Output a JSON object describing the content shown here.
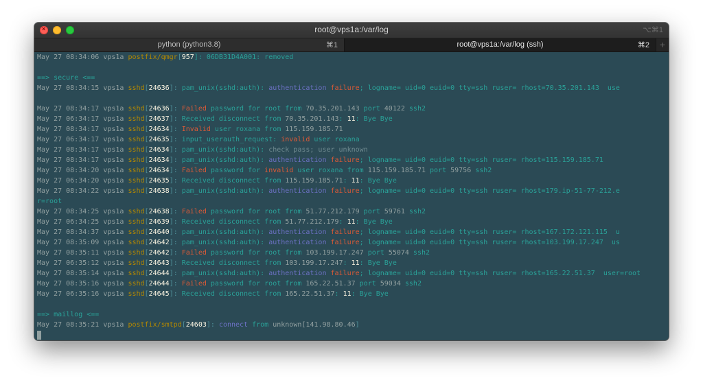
{
  "window": {
    "title": "root@vps1a:/var/log",
    "shortcut": "⌥⌘1",
    "close_glyph": "×"
  },
  "tabs": [
    {
      "label": "python (python3.8)",
      "shortcut": "⌘1",
      "active": false
    },
    {
      "label": "root@vps1a:/var/log (ssh)",
      "shortcut": "⌘2",
      "active": true
    }
  ],
  "new_tab_label": "+",
  "colors": {
    "terminal_bg": "#2b4a55",
    "text": "#93a1a1",
    "process": "#b58900",
    "pid": "#fdf6e3",
    "message_cyan": "#2aa198",
    "keyword_blue": "#6c71c4",
    "error_red": "#dc5a37"
  },
  "terminal": {
    "lines": [
      [
        [
          "May 27 08:34:06 vps1a ",
          "base"
        ],
        [
          "postfix/qmgr",
          "pfx"
        ],
        [
          "[",
          "dim"
        ],
        [
          "957",
          "pid"
        ],
        [
          "]: 06DB31D4A001: removed",
          "cyan"
        ]
      ],
      [],
      [
        [
          "==> secure <==",
          "cyan"
        ]
      ],
      [
        [
          "May 27 08:34:15 vps1a ",
          "base"
        ],
        [
          "sshd",
          "pfx"
        ],
        [
          "[",
          "dim"
        ],
        [
          "24636",
          "pid"
        ],
        [
          "]: ",
          "dim"
        ],
        [
          "pam_unix(sshd:auth): ",
          "cyan"
        ],
        [
          "authentication ",
          "blue"
        ],
        [
          "failure",
          "red"
        ],
        [
          "; logname= uid=0 euid=0 tty=ssh ruser= rhost=70.35.201.143  use",
          "cyan"
        ]
      ],
      [],
      [
        [
          "May 27 08:34:17 vps1a ",
          "base"
        ],
        [
          "sshd",
          "pfx"
        ],
        [
          "[",
          "dim"
        ],
        [
          "24636",
          "pid"
        ],
        [
          "]: ",
          "dim"
        ],
        [
          "Failed",
          "red"
        ],
        [
          " password for root from ",
          "cyan"
        ],
        [
          "70.35.201.143 ",
          "base"
        ],
        [
          "port ",
          "cyan"
        ],
        [
          "40122 ",
          "base"
        ],
        [
          "ssh2",
          "cyan"
        ]
      ],
      [
        [
          "May 27 06:34:17 vps1a ",
          "base"
        ],
        [
          "sshd",
          "pfx"
        ],
        [
          "[",
          "dim"
        ],
        [
          "24637",
          "pid"
        ],
        [
          "]: ",
          "dim"
        ],
        [
          "Received disconnect from ",
          "cyan"
        ],
        [
          "70.35.201.143",
          "base"
        ],
        [
          ": ",
          "cyan"
        ],
        [
          "11",
          "pid"
        ],
        [
          ": Bye Bye",
          "cyan"
        ]
      ],
      [
        [
          "May 27 08:34:17 vps1a ",
          "base"
        ],
        [
          "sshd",
          "pfx"
        ],
        [
          "[",
          "dim"
        ],
        [
          "24634",
          "pid"
        ],
        [
          "]: ",
          "dim"
        ],
        [
          "Invalid",
          "red"
        ],
        [
          " user roxana from ",
          "cyan"
        ],
        [
          "115.159.185.71",
          "base"
        ]
      ],
      [
        [
          "May 27 06:34:17 vps1a ",
          "base"
        ],
        [
          "sshd",
          "pfx"
        ],
        [
          "[",
          "dim"
        ],
        [
          "24635",
          "pid"
        ],
        [
          "]: ",
          "dim"
        ],
        [
          "input_userauth_request: ",
          "cyan"
        ],
        [
          "invalid",
          "red"
        ],
        [
          " user roxana",
          "cyan"
        ]
      ],
      [
        [
          "May 27 08:34:17 vps1a ",
          "base"
        ],
        [
          "sshd",
          "pfx"
        ],
        [
          "[",
          "dim"
        ],
        [
          "24634",
          "pid"
        ],
        [
          "]: ",
          "dim"
        ],
        [
          "pam_unix(sshd:auth): ",
          "cyan"
        ],
        [
          "check pass; user unknown",
          "gray"
        ]
      ],
      [
        [
          "May 27 08:34:17 vps1a ",
          "base"
        ],
        [
          "sshd",
          "pfx"
        ],
        [
          "[",
          "dim"
        ],
        [
          "24634",
          "pid"
        ],
        [
          "]: ",
          "dim"
        ],
        [
          "pam_unix(sshd:auth): ",
          "cyan"
        ],
        [
          "authentication ",
          "blue"
        ],
        [
          "failure",
          "red"
        ],
        [
          "; logname= uid=0 euid=0 tty=ssh ruser= rhost=115.159.185.71",
          "cyan"
        ]
      ],
      [
        [
          "May 27 08:34:20 vps1a ",
          "base"
        ],
        [
          "sshd",
          "pfx"
        ],
        [
          "[",
          "dim"
        ],
        [
          "24634",
          "pid"
        ],
        [
          "]: ",
          "dim"
        ],
        [
          "Failed",
          "red"
        ],
        [
          " password for ",
          "cyan"
        ],
        [
          "invalid",
          "red"
        ],
        [
          " user roxana from ",
          "cyan"
        ],
        [
          "115.159.185.71 ",
          "base"
        ],
        [
          "port ",
          "cyan"
        ],
        [
          "59756 ",
          "base"
        ],
        [
          "ssh2",
          "cyan"
        ]
      ],
      [
        [
          "May 27 06:34:20 vps1a ",
          "base"
        ],
        [
          "sshd",
          "pfx"
        ],
        [
          "[",
          "dim"
        ],
        [
          "24635",
          "pid"
        ],
        [
          "]: ",
          "dim"
        ],
        [
          "Received disconnect from ",
          "cyan"
        ],
        [
          "115.159.185.71",
          "base"
        ],
        [
          ": ",
          "cyan"
        ],
        [
          "11",
          "pid"
        ],
        [
          ": Bye Bye",
          "cyan"
        ]
      ],
      [
        [
          "May 27 08:34:22 vps1a ",
          "base"
        ],
        [
          "sshd",
          "pfx"
        ],
        [
          "[",
          "dim"
        ],
        [
          "24638",
          "pid"
        ],
        [
          "]: ",
          "dim"
        ],
        [
          "pam_unix(sshd:auth): ",
          "cyan"
        ],
        [
          "authentication ",
          "blue"
        ],
        [
          "failure",
          "red"
        ],
        [
          "; logname= uid=0 euid=0 tty=ssh ruser= rhost=179.ip-51-77-212.e",
          "cyan"
        ]
      ],
      [
        [
          "r=root",
          "cyan"
        ]
      ],
      [
        [
          "May 27 08:34:25 vps1a ",
          "base"
        ],
        [
          "sshd",
          "pfx"
        ],
        [
          "[",
          "dim"
        ],
        [
          "24638",
          "pid"
        ],
        [
          "]: ",
          "dim"
        ],
        [
          "Failed",
          "red"
        ],
        [
          " password for root from ",
          "cyan"
        ],
        [
          "51.77.212.179 ",
          "base"
        ],
        [
          "port ",
          "cyan"
        ],
        [
          "59761 ",
          "base"
        ],
        [
          "ssh2",
          "cyan"
        ]
      ],
      [
        [
          "May 27 06:34:25 vps1a ",
          "base"
        ],
        [
          "sshd",
          "pfx"
        ],
        [
          "[",
          "dim"
        ],
        [
          "24639",
          "pid"
        ],
        [
          "]: ",
          "dim"
        ],
        [
          "Received disconnect from ",
          "cyan"
        ],
        [
          "51.77.212.179",
          "base"
        ],
        [
          ": ",
          "cyan"
        ],
        [
          "11",
          "pid"
        ],
        [
          ": Bye Bye",
          "cyan"
        ]
      ],
      [
        [
          "May 27 08:34:37 vps1a ",
          "base"
        ],
        [
          "sshd",
          "pfx"
        ],
        [
          "[",
          "dim"
        ],
        [
          "24640",
          "pid"
        ],
        [
          "]: ",
          "dim"
        ],
        [
          "pam_unix(sshd:auth): ",
          "cyan"
        ],
        [
          "authentication ",
          "blue"
        ],
        [
          "failure",
          "red"
        ],
        [
          "; logname= uid=0 euid=0 tty=ssh ruser= rhost=167.172.121.115  u",
          "cyan"
        ]
      ],
      [
        [
          "May 27 08:35:09 vps1a ",
          "base"
        ],
        [
          "sshd",
          "pfx"
        ],
        [
          "[",
          "dim"
        ],
        [
          "24642",
          "pid"
        ],
        [
          "]: ",
          "dim"
        ],
        [
          "pam_unix(sshd:auth): ",
          "cyan"
        ],
        [
          "authentication ",
          "blue"
        ],
        [
          "failure",
          "red"
        ],
        [
          "; logname= uid=0 euid=0 tty=ssh ruser= rhost=103.199.17.247  us",
          "cyan"
        ]
      ],
      [
        [
          "May 27 08:35:11 vps1a ",
          "base"
        ],
        [
          "sshd",
          "pfx"
        ],
        [
          "[",
          "dim"
        ],
        [
          "24642",
          "pid"
        ],
        [
          "]: ",
          "dim"
        ],
        [
          "Failed",
          "red"
        ],
        [
          " password for root from ",
          "cyan"
        ],
        [
          "103.199.17.247 ",
          "base"
        ],
        [
          "port ",
          "cyan"
        ],
        [
          "55074 ",
          "base"
        ],
        [
          "ssh2",
          "cyan"
        ]
      ],
      [
        [
          "May 27 06:35:12 vps1a ",
          "base"
        ],
        [
          "sshd",
          "pfx"
        ],
        [
          "[",
          "dim"
        ],
        [
          "24643",
          "pid"
        ],
        [
          "]: ",
          "dim"
        ],
        [
          "Received disconnect from ",
          "cyan"
        ],
        [
          "103.199.17.247",
          "base"
        ],
        [
          ": ",
          "cyan"
        ],
        [
          "11",
          "pid"
        ],
        [
          ": Bye Bye",
          "cyan"
        ]
      ],
      [
        [
          "May 27 08:35:14 vps1a ",
          "base"
        ],
        [
          "sshd",
          "pfx"
        ],
        [
          "[",
          "dim"
        ],
        [
          "24644",
          "pid"
        ],
        [
          "]: ",
          "dim"
        ],
        [
          "pam_unix(sshd:auth): ",
          "cyan"
        ],
        [
          "authentication ",
          "blue"
        ],
        [
          "failure",
          "red"
        ],
        [
          "; logname= uid=0 euid=0 tty=ssh ruser= rhost=165.22.51.37  user=root",
          "cyan"
        ]
      ],
      [
        [
          "May 27 08:35:16 vps1a ",
          "base"
        ],
        [
          "sshd",
          "pfx"
        ],
        [
          "[",
          "dim"
        ],
        [
          "24644",
          "pid"
        ],
        [
          "]: ",
          "dim"
        ],
        [
          "Failed",
          "red"
        ],
        [
          " password for root from ",
          "cyan"
        ],
        [
          "165.22.51.37 ",
          "base"
        ],
        [
          "port ",
          "cyan"
        ],
        [
          "59034 ",
          "base"
        ],
        [
          "ssh2",
          "cyan"
        ]
      ],
      [
        [
          "May 27 06:35:16 vps1a ",
          "base"
        ],
        [
          "sshd",
          "pfx"
        ],
        [
          "[",
          "dim"
        ],
        [
          "24645",
          "pid"
        ],
        [
          "]: ",
          "dim"
        ],
        [
          "Received disconnect from ",
          "cyan"
        ],
        [
          "165.22.51.37",
          "base"
        ],
        [
          ": ",
          "cyan"
        ],
        [
          "11",
          "pid"
        ],
        [
          ": Bye Bye",
          "cyan"
        ]
      ],
      [],
      [
        [
          "==> maillog <==",
          "cyan"
        ]
      ],
      [
        [
          "May 27 08:35:21 vps1a ",
          "base"
        ],
        [
          "postfix/smtpd",
          "pfx"
        ],
        [
          "[",
          "dim"
        ],
        [
          "24603",
          "pid"
        ],
        [
          "]: ",
          "dim"
        ],
        [
          "connect ",
          "blue"
        ],
        [
          "from ",
          "cyan"
        ],
        [
          "unknown[",
          "base"
        ],
        [
          "141.98.80.46",
          "base"
        ],
        [
          "]",
          "dim"
        ]
      ]
    ]
  }
}
